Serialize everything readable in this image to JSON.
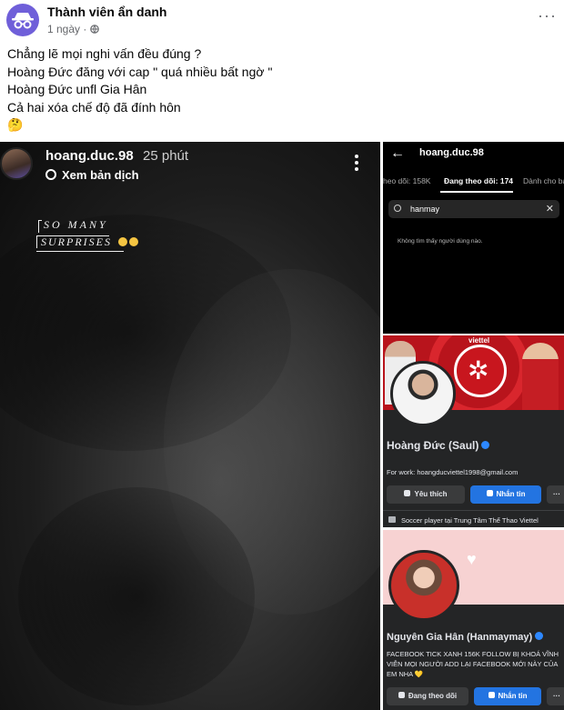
{
  "post": {
    "author": "Thành viên ẩn danh",
    "time": "1 ngày · ",
    "privacy_icon": "globe-icon",
    "menu_icon": "more-horizontal-icon",
    "menu_label": "···"
  },
  "caption": {
    "lines": [
      "Chẳng lẽ mọi nghi vấn đều đúng ?",
      "Hoàng Đức đăng với cap \" quá nhiều bất ngờ \"",
      "Hoàng Đức unfl Gia Hân",
      "Cả hai xóa chế độ đã đính hôn",
      "🤔"
    ]
  },
  "story": {
    "username": "hoang.duc.98",
    "time": "25 phút",
    "translate": "Xem bản dịch",
    "sticker_line1": "SO MANY",
    "sticker_line2": "SURPRISES"
  },
  "following": {
    "back_icon": "back-arrow-icon",
    "back_glyph": "←",
    "username": "hoang.duc.98",
    "tabs": [
      "heo dõi: 158K",
      "Đang theo dõi: 174",
      "Dành cho ba"
    ],
    "search_value": "hanmay",
    "clear_glyph": "✕",
    "empty_text": "Không tìm thấy người dùng nào."
  },
  "profile_duc": {
    "brand": "viettel",
    "name": "Hoàng Đức (Saul)",
    "work": "For work: hoangducviettel1998@gmail.com",
    "like_label": "Yêu thích",
    "message_label": "Nhắn tin",
    "more_label": "···",
    "about": "Soccer player tại Trung Tâm Thể Thao Viettel"
  },
  "profile_han": {
    "heart_glyph": "♥",
    "name": "Nguyên Gia Hân (Hanmaymay)",
    "bio": "FACEBOOK TICK XANH 156K FOLLOW BỊ KHOÁ VĨNH VIỄN MỌI NGƯỜI ADD LẠI FACEBOOK MỚI NÀY CỦA EM NHA 💛",
    "following_label": "Đang theo dõi",
    "message_label": "Nhắn tin",
    "more_label": "···"
  },
  "colors": {
    "facebook_blue": "#2374e1",
    "anon_purple": "#6f5fd9",
    "viettel_red": "#b8141c"
  }
}
